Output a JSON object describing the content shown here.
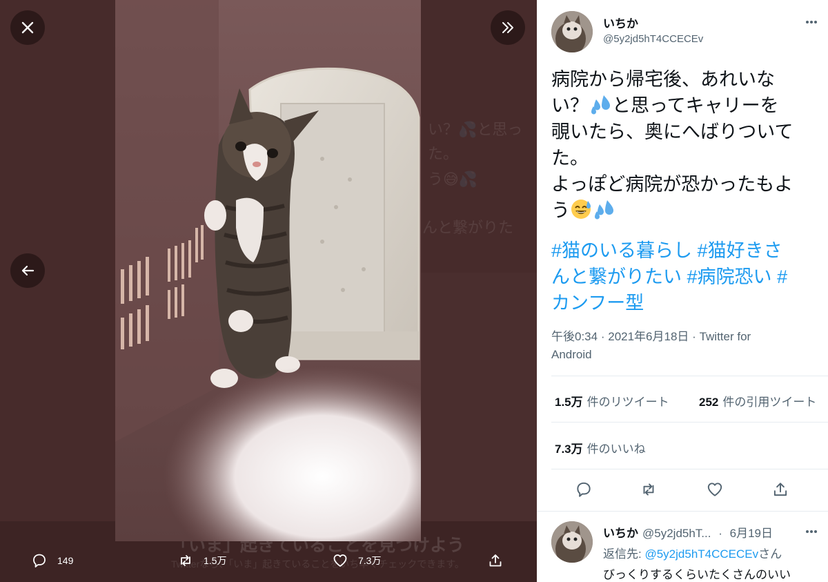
{
  "viewer": {
    "close_icon": "close-icon",
    "expand_icon": "double-chevron-right-icon",
    "prev_icon": "arrow-left-icon",
    "background_text": {
      "line1": "い？💦と思っ",
      "line2": "た。",
      "line3": "う😅💦",
      "line4": "んと繋がりた",
      "bottom_title": "「いま」起きていることを見つけよう",
      "bottom_sub": "Twitterなら、「いま」起きていることをいち早くチェックできます。"
    },
    "actions": {
      "reply_count": "149",
      "retweet_count": "1.5万",
      "like_count": "7.3万"
    }
  },
  "tweet": {
    "author": {
      "name": "いちか",
      "handle": "@5y2jd5hT4CCECEv"
    },
    "text_lines": [
      "病院から帰宅後、あれいな",
      "い？",
      "と思ってキャリーを",
      "覗いたら、奥にへばりついて",
      "た。",
      "よっぽど病院が恐かったもよ",
      "う"
    ],
    "hashtags": {
      "line1_a": "#猫のいる暮らし",
      "line1_b": "#猫好きさ",
      "line2_a": "んと繋がりたい",
      "line2_b": "#病院恐い",
      "line2_c": "#",
      "line3": "カンフー型"
    },
    "meta": {
      "time": "午後0:34",
      "sep1": "·",
      "date": "2021年6月18日",
      "sep2": "·",
      "source_a": "Twitter for",
      "source_b": "Android"
    },
    "stats": {
      "retweets_num": "1.5万",
      "retweets_label": "件のリツイート",
      "quotes_num": "252",
      "quotes_label": "件の引用ツイート",
      "likes_num": "7.3万",
      "likes_label": "件のいいね"
    }
  },
  "reply": {
    "name": "いちか",
    "handle": "@5y2jd5hT...",
    "sep": "·",
    "date": "6月19日",
    "reply_to_label": "返信先:",
    "reply_to_handle": "@5y2jd5hT4CCECEv",
    "reply_to_suffix": "さん",
    "text": "びっくりするくらいたくさんのいい"
  },
  "colors": {
    "accent": "#1d9bf0",
    "viewer_bg": "#472b2b",
    "text_primary": "#0f1419",
    "text_secondary": "#536471"
  }
}
